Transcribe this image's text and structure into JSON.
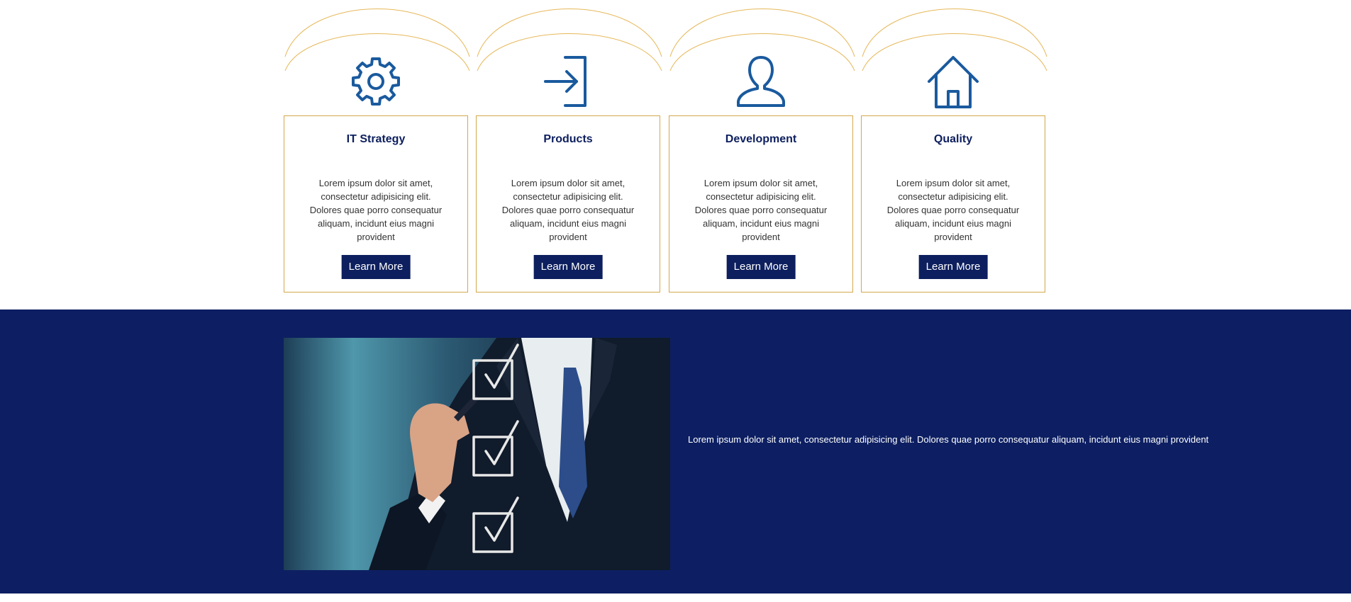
{
  "colors": {
    "accent_gold": "#d4a84b",
    "navy": "#0d1f5e",
    "icon_blue": "#1a5a9e",
    "band_bg": "#0d1f62"
  },
  "cards": [
    {
      "icon": "gear-icon",
      "title": "IT Strategy",
      "text": "Lorem ipsum dolor sit amet, consectetur adipisicing elit. Dolores quae porro consequatur aliquam, incidunt eius magni provident",
      "button": "Learn More"
    },
    {
      "icon": "sign-in-icon",
      "title": "Products",
      "text": "Lorem ipsum dolor sit amet, consectetur adipisicing elit. Dolores quae porro consequatur aliquam, incidunt eius magni provident",
      "button": "Learn More"
    },
    {
      "icon": "user-icon",
      "title": "Development",
      "text": "Lorem ipsum dolor sit amet, consectetur adipisicing elit. Dolores quae porro consequatur aliquam, incidunt eius magni provident",
      "button": "Learn More"
    },
    {
      "icon": "home-icon",
      "title": "Quality",
      "text": "Lorem ipsum dolor sit amet, consectetur adipisicing elit. Dolores quae porro consequatur aliquam, incidunt eius magni provident",
      "button": "Learn More"
    }
  ],
  "feature": {
    "image": "businessman-checklist-photo",
    "text": "Lorem ipsum dolor sit amet, consectetur adipisicing elit. Dolores quae porro consequatur aliquam, incidunt eius magni provident"
  }
}
